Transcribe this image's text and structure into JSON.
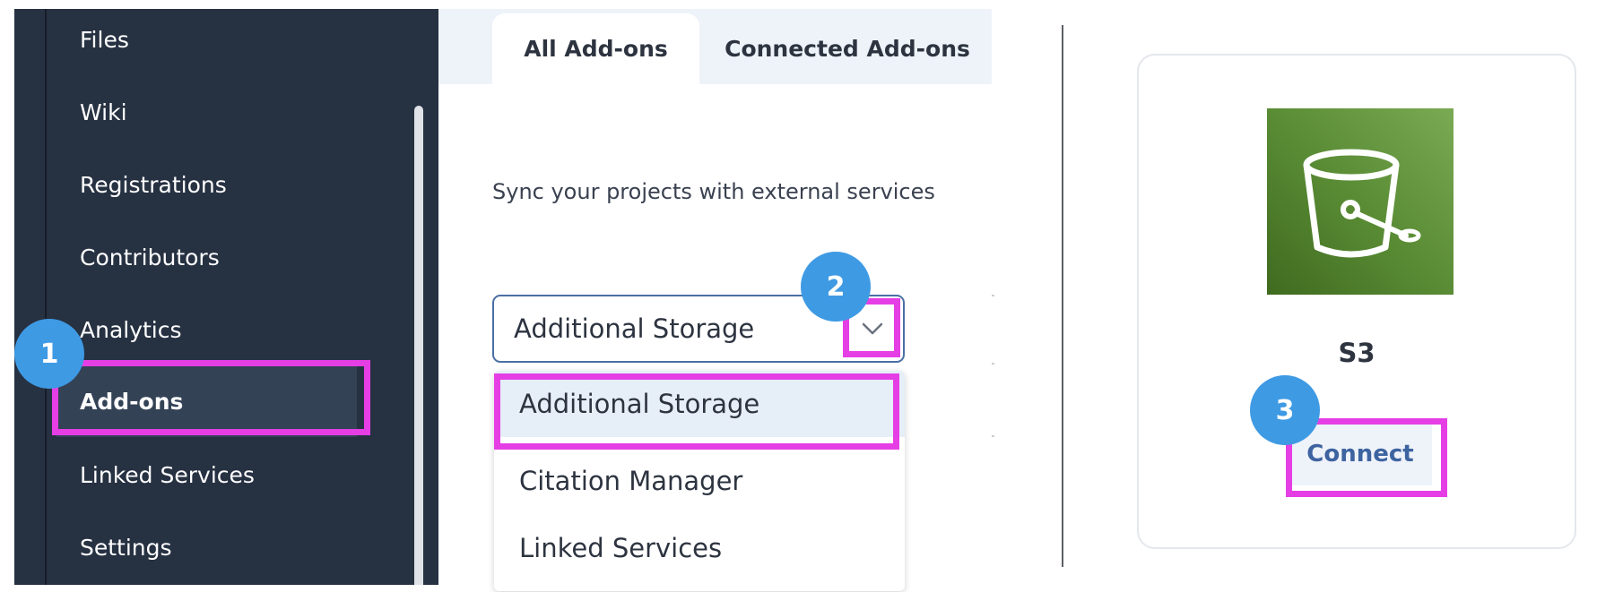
{
  "sidebar": {
    "items": [
      {
        "label": "Files"
      },
      {
        "label": "Wiki"
      },
      {
        "label": "Registrations"
      },
      {
        "label": "Contributors"
      },
      {
        "label": "Analytics"
      },
      {
        "label": "Add-ons",
        "active": true
      },
      {
        "label": "Linked Services"
      },
      {
        "label": "Settings"
      }
    ]
  },
  "tabs": [
    {
      "label": "All Add-ons",
      "active": true
    },
    {
      "label": "Connected Add-ons",
      "active": false
    }
  ],
  "main": {
    "description": "Sync your projects with external services",
    "category_select": {
      "value": "Additional Storage",
      "options": [
        "Additional Storage",
        "Citation Manager",
        "Linked Services"
      ]
    }
  },
  "card": {
    "title": "S3",
    "icon": "bucket-icon",
    "connect_label": "Connect"
  },
  "annotations": {
    "steps": [
      "1",
      "2",
      "3"
    ],
    "highlight_color": "#e53ee5",
    "badge_color": "#3f9ae4"
  },
  "colors": {
    "sidebar_bg": "#263142",
    "sidebar_active_bg": "#344256",
    "tab_strip_bg": "#eef3fa",
    "select_border": "#4a6fa5",
    "option_selected_bg": "#e6eef8",
    "connect_text": "#3d63a0"
  }
}
